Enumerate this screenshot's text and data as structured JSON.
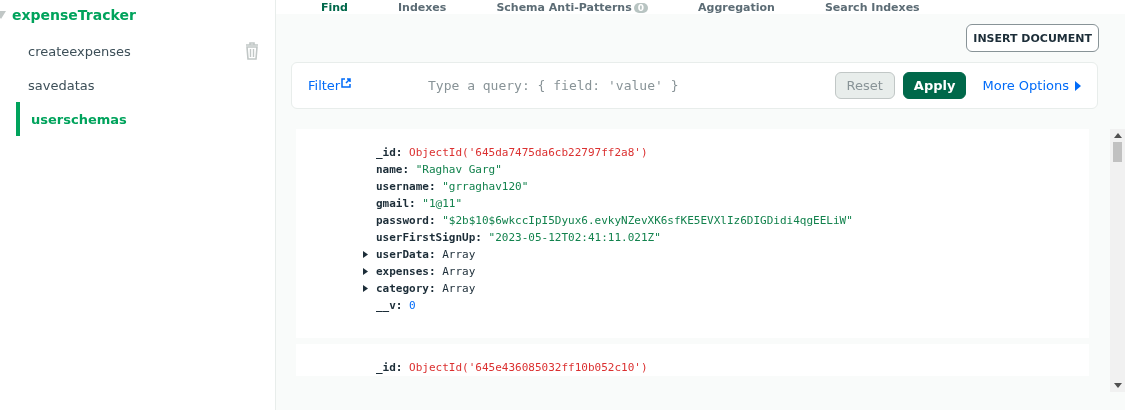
{
  "sidebar": {
    "database": {
      "name": "expenseTracker",
      "expanded": true
    },
    "collections": [
      {
        "name": "createexpenses",
        "selected": false,
        "hovered": true
      },
      {
        "name": "savedatas",
        "selected": false,
        "hovered": false
      },
      {
        "name": "userschemas",
        "selected": true,
        "hovered": false
      }
    ]
  },
  "tabs": [
    {
      "label": "Find",
      "selected": true
    },
    {
      "label": "Indexes",
      "selected": false
    },
    {
      "label": "Schema Anti-Patterns",
      "badge": "0",
      "selected": false
    },
    {
      "label": "Aggregation",
      "selected": false
    },
    {
      "label": "Search Indexes",
      "selected": false
    }
  ],
  "insert_button": "INSERT DOCUMENT",
  "filter": {
    "label": "Filter",
    "placeholder": "Type a query: { field: 'value' }",
    "reset": "Reset",
    "apply": "Apply",
    "more": "More Options"
  },
  "documents": [
    {
      "fields": [
        {
          "key": "_id:",
          "value": "ObjectId('645da7475da6cb22797ff2a8')",
          "kind": "objectid"
        },
        {
          "key": "name:",
          "value": "\"Raghav Garg\"",
          "kind": "string"
        },
        {
          "key": "username:",
          "value": "\"grraghav120\"",
          "kind": "string"
        },
        {
          "key": "gmail:",
          "value": "\"1@11\"",
          "kind": "string"
        },
        {
          "key": "password:",
          "value": "\"$2b$10$6wkccIpI5Dyux6.evkyNZevXK6sfKE5EVXlIz6DIGDidi4qgEELiW\"",
          "kind": "string"
        },
        {
          "key": "userFirstSignUp:",
          "value": "\"2023-05-12T02:41:11.021Z\"",
          "kind": "string"
        },
        {
          "key": "userData:",
          "value": "Array",
          "kind": "array",
          "expanded": false
        },
        {
          "key": "expenses:",
          "value": "Array",
          "kind": "array",
          "expanded": false
        },
        {
          "key": "category:",
          "value": "Array",
          "kind": "array",
          "expanded": false
        },
        {
          "key": "__v:",
          "value": "0",
          "kind": "number"
        }
      ]
    },
    {
      "fields": [
        {
          "key": "_id:",
          "value": "ObjectId('645e436085032ff10b052c10')",
          "kind": "objectid"
        }
      ]
    }
  ]
}
